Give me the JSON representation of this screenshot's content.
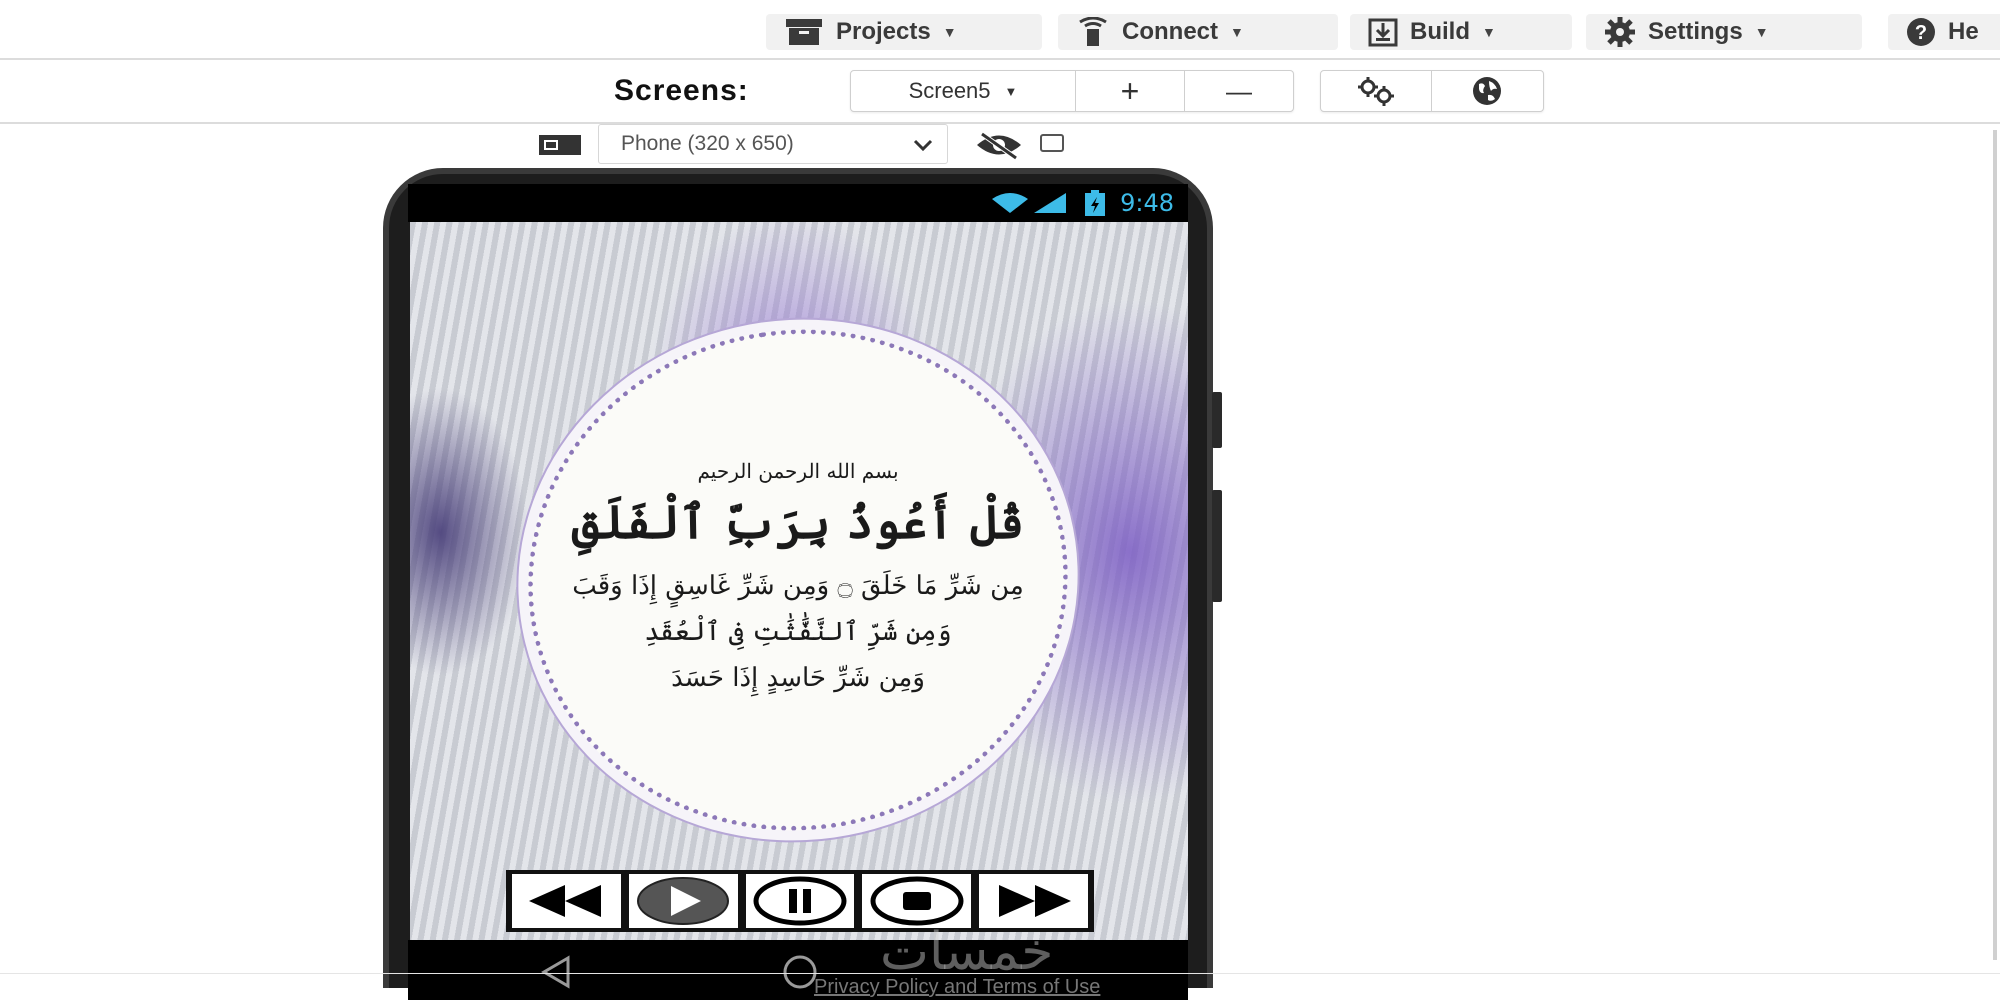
{
  "menu": {
    "projects": "Projects",
    "connect": "Connect",
    "build": "Build",
    "settings": "Settings",
    "help": "He"
  },
  "screens": {
    "label": "Screens:",
    "current": "Screen5",
    "add": "+",
    "remove": "—"
  },
  "preview": {
    "device": "Phone (320 x 650)"
  },
  "phone": {
    "time": "9:48",
    "basmala": "بسم الله الرحمن الرحيم",
    "verses": [
      "قُلْ أَعُوذُ بِرَبِّ ٱلْفَلَقِ",
      "مِن شَرِّ مَا خَلَقَ ۝ وَمِن شَرِّ غَاسِقٍ إِذَا وَقَبَ",
      "وَمِن شَرِّ ٱلنَّفَّٰثَٰتِ فِى ٱلْعُقَدِ",
      "وَمِن شَرِّ حَاسِدٍ إِذَا حَسَدَ"
    ],
    "watermark": "خمسات"
  },
  "footer": {
    "privacy": "Privacy Policy and Terms of Use"
  },
  "colors": {
    "accent_time": "#3dbbe8",
    "menu_bg": "#f1f1f1"
  }
}
